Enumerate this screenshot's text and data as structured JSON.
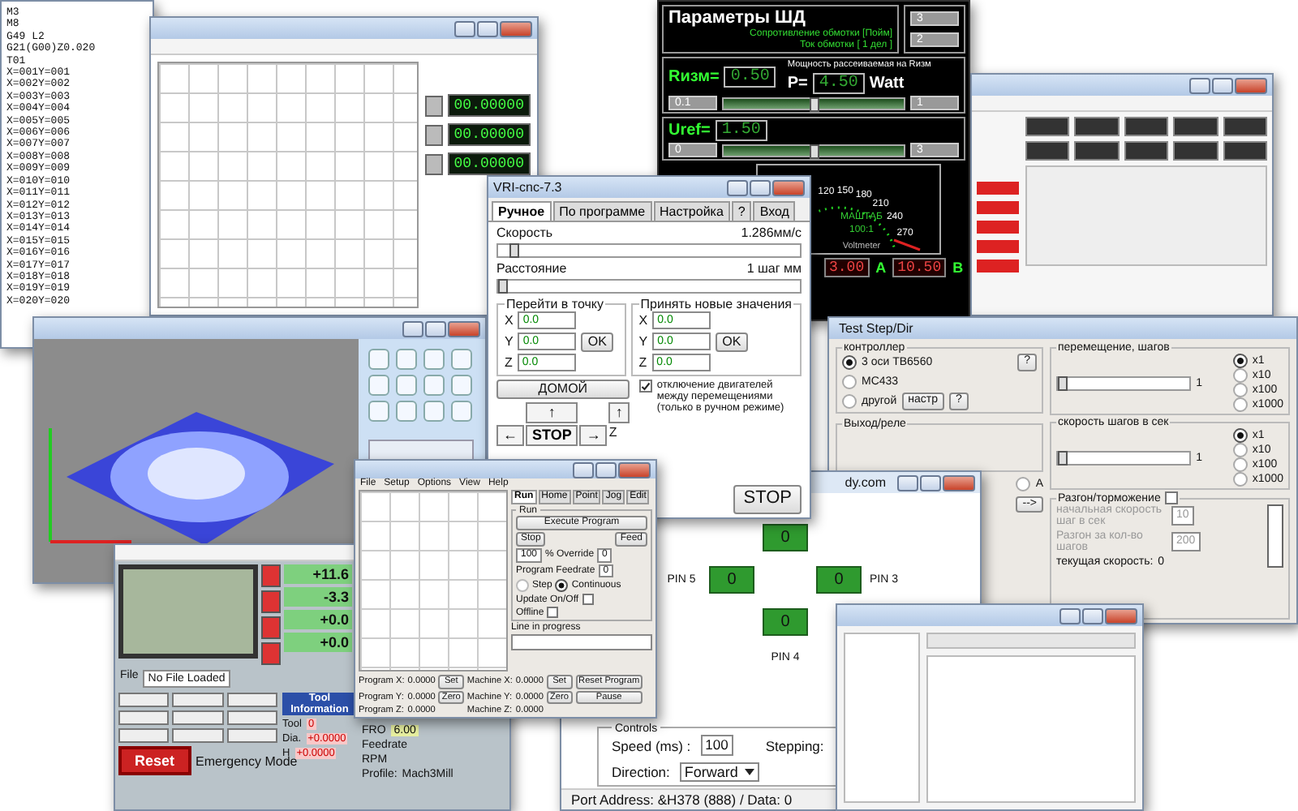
{
  "gcode_listing": {
    "lines": [
      "M3",
      "M8",
      "G49 L2",
      "G21(G00)Z0.020",
      "T01",
      "X=001Y=001",
      "X=002Y=002",
      "X=003Y=003",
      "X=004Y=004",
      "X=005Y=005",
      "X=006Y=006",
      "X=007Y=007",
      "X=008Y=008",
      "X=009Y=009",
      "X=010Y=010",
      "X=011Y=011",
      "X=012Y=012",
      "X=013Y=013",
      "X=014Y=014",
      "X=015Y=015",
      "X=016Y=016",
      "X=017Y=017",
      "X=018Y=018",
      "X=019Y=019",
      "X=020Y=020"
    ]
  },
  "grid_editor": {
    "readouts": [
      "00.00000",
      "00.00000",
      "00.00000"
    ]
  },
  "stepper_parameters": {
    "title": "Параметры  ШД",
    "lines": [
      "Сопротивление обмотки [Пойм]",
      "Ток обмотки [ 1 дел ]"
    ],
    "inputs": [
      "3",
      "2"
    ],
    "r_label": "Rизм=",
    "r_value": "0.50",
    "power_caption": "Мощность рассеиваемая на Rизм",
    "p_label": "P=",
    "p_value": "4.50",
    "p_unit": "Watt",
    "r_slider": {
      "min": "0.1",
      "max": "1",
      "level": 0.5
    },
    "uref_label": "Uref=",
    "uref_value": "1.50",
    "uref_slider": {
      "min": "0",
      "max": "3",
      "level": 0.5
    },
    "gauge": {
      "ticks": [
        "120",
        "150",
        "180",
        "210",
        "240",
        "270"
      ],
      "caption": "МАШТАБ",
      "scale": "100:1",
      "label": "Voltmeter"
    },
    "outputs": [
      {
        "value": "3.00",
        "unit": "A"
      },
      {
        "value": "10.50",
        "unit": "B"
      }
    ]
  },
  "test_step_dir": {
    "title": "Test Step/Dir",
    "controller": {
      "label": "контроллер",
      "options": [
        {
          "label": "3 оси TB6560",
          "selected": true
        },
        {
          "label": "MC433",
          "selected": false
        },
        {
          "label": "другой",
          "selected": false
        }
      ],
      "help_buttons": [
        "?",
        "?"
      ],
      "setup_button": "настр"
    },
    "relay": {
      "label": "Выход/реле"
    },
    "axis_option": {
      "label": "A",
      "selected": false
    },
    "go_button": "-->",
    "steps": {
      "label": "перемещение, шагов",
      "reading": "1",
      "level": 0,
      "multipliers": [
        {
          "label": "x1",
          "selected": true
        },
        {
          "label": "x10",
          "selected": false
        },
        {
          "label": "x100",
          "selected": false
        },
        {
          "label": "x1000",
          "selected": false
        }
      ]
    },
    "rate": {
      "label": "скорость шагов в сек",
      "reading": "1",
      "level": 0,
      "multipliers": [
        {
          "label": "x1",
          "selected": true
        },
        {
          "label": "x10",
          "selected": false
        },
        {
          "label": "x100",
          "selected": false
        },
        {
          "label": "x1000",
          "selected": false
        }
      ]
    },
    "accel": {
      "label": "Разгон/торможение",
      "checked": false,
      "fields": [
        {
          "label": "начальная скорость шаг в сек",
          "value": "10"
        },
        {
          "label": "Разгон за кол-во шагов",
          "value": "200"
        }
      ]
    },
    "current": {
      "label": "текущая скорость:",
      "value": "0",
      "level": 0
    }
  },
  "pin_tester": {
    "title": "dy.com",
    "pins": [
      {
        "value": "0"
      },
      {
        "label": "PIN 5",
        "value": "0"
      },
      {
        "label": "PIN 3",
        "value": "0"
      },
      {
        "label": "PIN 4",
        "value": "0"
      }
    ],
    "controls_label": "Controls",
    "speed_label": "Speed (ms) :",
    "speed_value": "100",
    "stepping_label": "Stepping:",
    "direction_label": "Direction:",
    "direction_value": "Forward",
    "status": "Port Address: &H378 (888)  /  Data: 0"
  },
  "vri_cnc": {
    "title": "VRI-cnc-7.3",
    "tabs": [
      {
        "label": "Ручное",
        "selected": true
      },
      {
        "label": "По программе",
        "selected": false
      },
      {
        "label": "Настройка",
        "selected": false
      },
      {
        "label": "?",
        "selected": false
      },
      {
        "label": "Вход",
        "selected": false
      }
    ],
    "speed": {
      "label": "Скорость",
      "reading": "1.286мм/с",
      "level": 0.04
    },
    "distance": {
      "label": "Расстояние",
      "reading": "1 шаг мм",
      "level": 0
    },
    "goto": {
      "title": "Перейти в точку",
      "axes": [
        {
          "axis": "X",
          "value": "0.0"
        },
        {
          "axis": "Y",
          "value": "0.0"
        },
        {
          "axis": "Z",
          "value": "0.0"
        }
      ],
      "button": "OK"
    },
    "set": {
      "title": "Принять новые значения",
      "axes": [
        {
          "axis": "X",
          "value": "0.0"
        },
        {
          "axis": "Y",
          "value": "0.0"
        },
        {
          "axis": "Z",
          "value": "0.0"
        }
      ],
      "button": "OK"
    },
    "home_button": "ДОМОЙ",
    "motor_off": {
      "label": "отключение двигателей между перемещениями (только в ручном режиме)",
      "checked": true
    },
    "jog": {
      "up": "↑",
      "left": "←",
      "stop": "STOP",
      "right": "→",
      "z_up": "↑",
      "z": "Z"
    },
    "stop_button": "STOP"
  },
  "mach3": {
    "dros": [
      "+11.6",
      "-3.3",
      "+0.0",
      "+0.0"
    ],
    "file_label": "File",
    "file_value": "No File Loaded",
    "tool_info": "Tool Information",
    "tool": {
      "label": "Tool",
      "value": "0"
    },
    "dia": {
      "label": "Dia.",
      "value": "+0.0000"
    },
    "h": {
      "label": "H",
      "value": "+0.0000"
    },
    "reset_button": "Reset",
    "emergency": "Emergency Mode",
    "fro_label": "FRO",
    "fro_value": "6.00",
    "feedrate_label": "Feedrate",
    "rpm_label": "RPM",
    "profile_label": "Profile:",
    "profile_value": "Mach3Mill"
  },
  "turbo_cnc": {
    "menu": [
      "File",
      "Setup",
      "Options",
      "View",
      "Help"
    ],
    "tabs": [
      {
        "label": "Run",
        "selected": true
      },
      {
        "label": "Home",
        "selected": false
      },
      {
        "label": "Point",
        "selected": false
      },
      {
        "label": "Jog",
        "selected": false
      },
      {
        "label": "Edit",
        "selected": false
      }
    ],
    "run_group": "Run",
    "execute_button": "Execute Program",
    "stop_button": "Stop",
    "feed_button": "Feed",
    "override_select": "100",
    "override_label": "% Override",
    "override_value": "0",
    "feedrate_label": "Program Feedrate",
    "feedrate_value": "0",
    "modes": [
      {
        "label": "Step",
        "selected": false
      },
      {
        "label": "Continuous",
        "selected": true
      }
    ],
    "options": [
      {
        "label": "Update On/Off",
        "checked": false
      },
      {
        "label": "Offline",
        "checked": false
      }
    ],
    "line_label": "Line in progress",
    "program": [
      {
        "label": "Program X:",
        "value": "0.0000"
      },
      {
        "label": "Program Y:",
        "value": "0.0000"
      },
      {
        "label": "Program Z:",
        "value": "0.0000"
      }
    ],
    "machine": [
      {
        "label": "Machine X:",
        "value": "0.0000"
      },
      {
        "label": "Machine Y:",
        "value": "0.0000"
      },
      {
        "label": "Machine Z:",
        "value": "0.0000"
      }
    ],
    "set_buttons": [
      "Set",
      "Zero"
    ],
    "machine_buttons": [
      "Set",
      "Zero"
    ],
    "reset_button": "Reset Program",
    "pause_button": "Pause"
  }
}
